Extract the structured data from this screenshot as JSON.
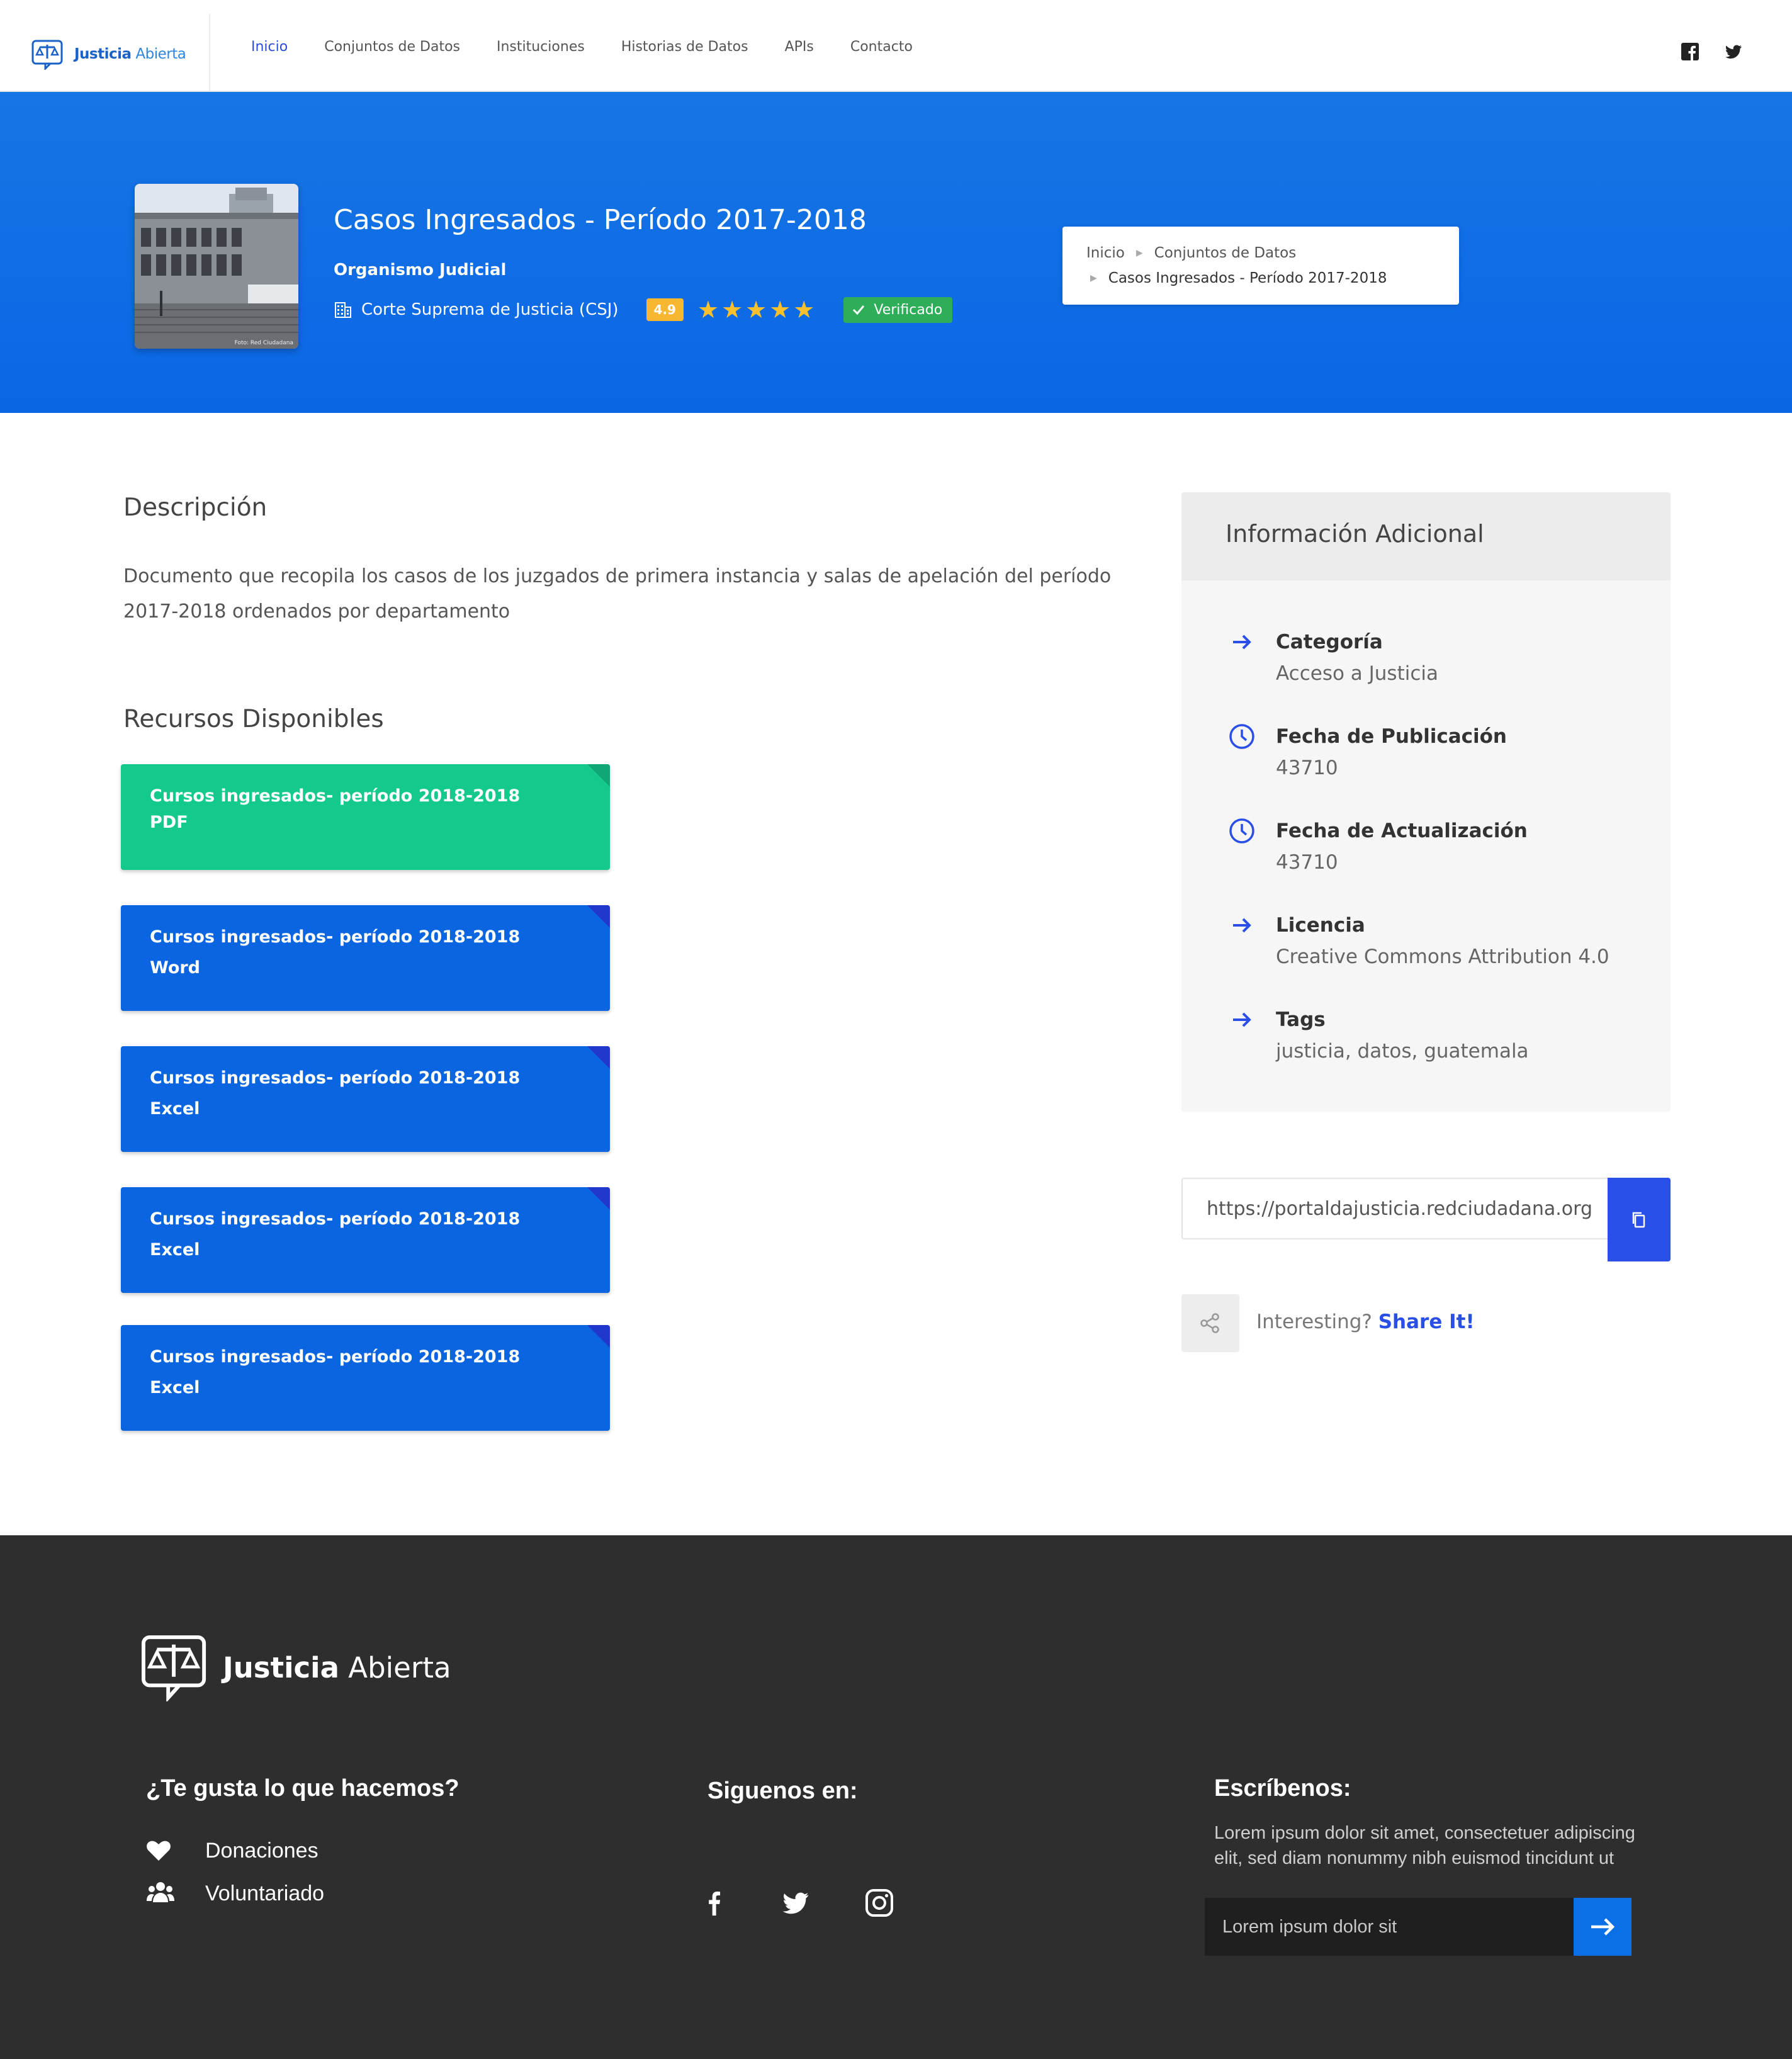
{
  "nav": {
    "brand_bold": "Justicia",
    "brand_light": "Abierta",
    "links": [
      {
        "label": "Inicio",
        "active": true
      },
      {
        "label": "Conjuntos de Datos",
        "active": false
      },
      {
        "label": "Instituciones",
        "active": false
      },
      {
        "label": "Historias de Datos",
        "active": false
      },
      {
        "label": "APIs",
        "active": false
      },
      {
        "label": "Contacto",
        "active": false
      }
    ],
    "social_icons": [
      "facebook-icon",
      "twitter-icon"
    ]
  },
  "hero": {
    "title": "Casos Ingresados - Período 2017-2018",
    "organization": "Organismo Judicial",
    "institution": "Corte Suprema de Justicia (CSJ)",
    "rating": "4.9",
    "stars": 5,
    "verified_label": "Verificado",
    "image_caption": "Foto: Red Ciudadana",
    "breadcrumb": [
      "Inicio",
      "Conjuntos de Datos",
      "Casos Ingresados - Período 2017-2018"
    ]
  },
  "description": {
    "title": "Descripción",
    "text": "Documento que recopila los casos de los juzgados de primera instancia y salas de apelación del período 2017-2018 ordenados por departamento"
  },
  "resources": {
    "title": "Recursos Disponibles",
    "items": [
      {
        "title": "Cursos ingresados- período 2018-2018",
        "format": "PDF",
        "color": "#14c98c"
      },
      {
        "title": "Cursos ingresados- período 2018-2018",
        "format": "Word",
        "color": "#0b64e0"
      },
      {
        "title": "Cursos ingresados- período 2018-2018",
        "format": "Excel",
        "color": "#0b64e0"
      },
      {
        "title": "Cursos ingresados- período 2018-2018",
        "format": "Excel",
        "color": "#0b64e0"
      },
      {
        "title": "Cursos ingresados- período 2018-2018",
        "format": "Excel",
        "color": "#0b64e0"
      }
    ]
  },
  "info": {
    "title": "Información Adicional",
    "items": [
      {
        "label": "Categoría",
        "value": "Acceso a Justicia",
        "icon": "arrow-right-icon"
      },
      {
        "label": "Fecha de Publicación",
        "value": "43710",
        "icon": "clock-icon"
      },
      {
        "label": "Fecha de Actualización",
        "value": "43710",
        "icon": "clock-icon"
      },
      {
        "label": "Licencia",
        "value": "Creative Commons Attribution 4.0",
        "icon": "arrow-right-icon"
      },
      {
        "label": "Tags",
        "value": "justicia, datos, guatemala",
        "icon": "arrow-right-icon"
      }
    ],
    "url": "https://portaldajusticia.redciudadana.org",
    "share_prefix": "Interesting?",
    "share_link": "Share It!"
  },
  "footer": {
    "brand_bold": "Justicia",
    "brand_light": "Abierta",
    "col1_title": "¿Te gusta lo que hacemos?",
    "links": [
      {
        "label": "Donaciones",
        "icon": "heart-icon"
      },
      {
        "label": "Voluntariado",
        "icon": "users-icon"
      }
    ],
    "col2_title": "Siguenos en:",
    "social_icons": [
      "facebook-icon",
      "twitter-icon",
      "instagram-icon"
    ],
    "col3_title": "Escríbenos:",
    "col3_text": "Lorem ipsum dolor sit amet, consectetuer adipiscing elit, sed diam nonummy nibh euismod tincidunt ut",
    "input_placeholder": "Lorem ipsum dolor sit"
  },
  "colors": {
    "primary": "#0b64e0",
    "accent": "#2a4fe6",
    "green": "#14c98c",
    "footer_bg": "#2e2e2e",
    "star": "#f8c02d"
  }
}
